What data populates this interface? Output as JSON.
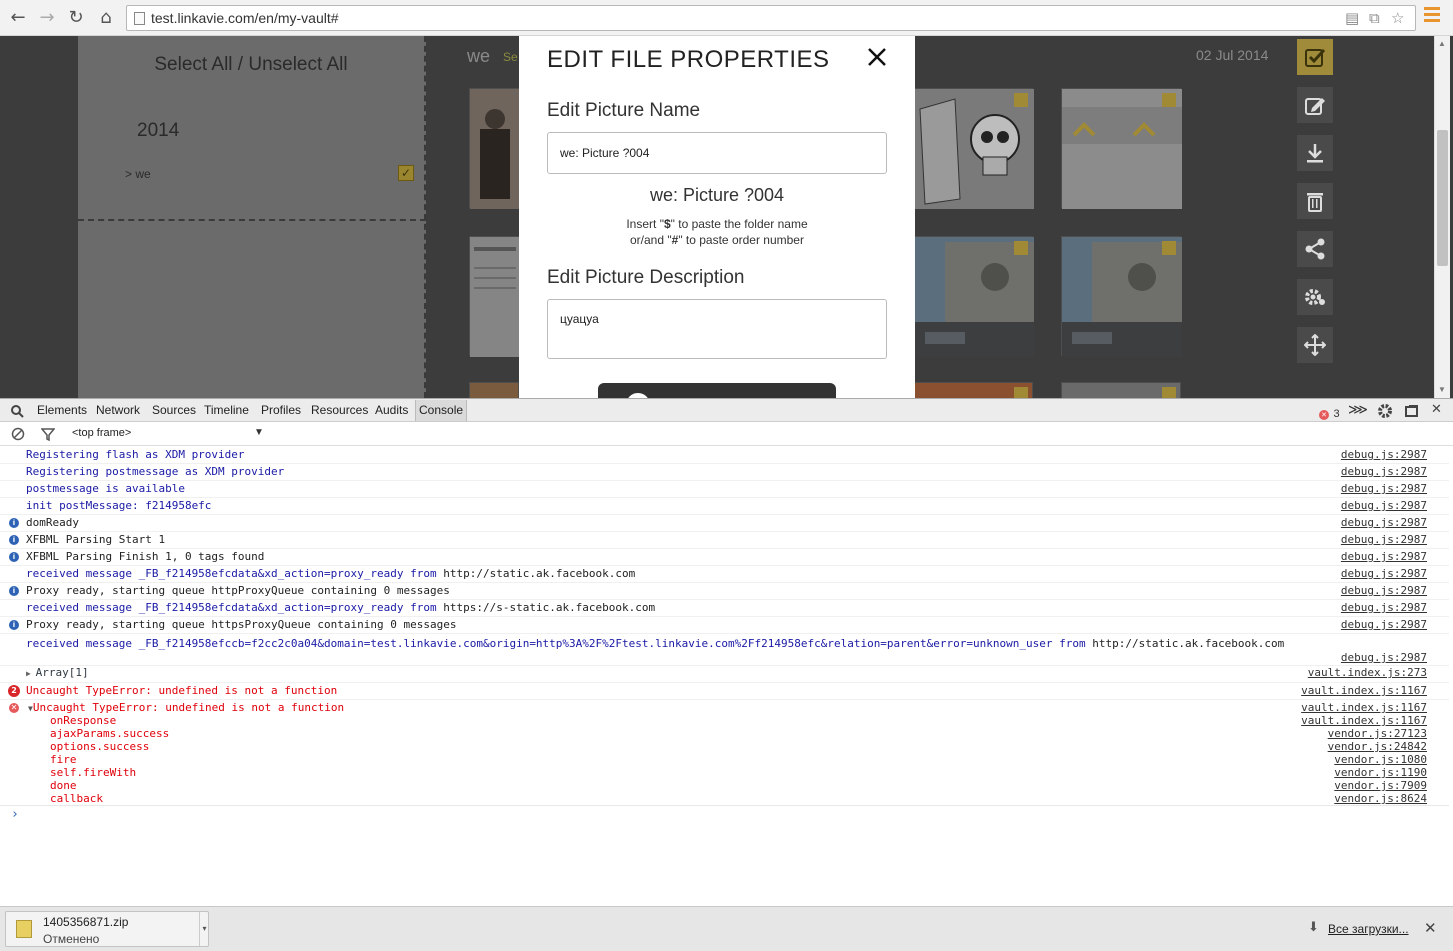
{
  "browser": {
    "url": "test.linkavie.com/en/my-vault#"
  },
  "page": {
    "select_all": "Select All / Unselect All",
    "year": "2014",
    "folder_item": "> we",
    "folder_title": "we",
    "folder_select": "Se",
    "date": "02 Jul 2014",
    "tools": [
      "select-icon",
      "edit-icon",
      "download-icon",
      "trash-icon",
      "share-icon",
      "settings-icon",
      "move-icon"
    ],
    "accent": "#a08a35"
  },
  "modal": {
    "title": "EDIT FILE PROPERTIES",
    "name_label": "Edit Picture Name",
    "name_value": "we: Picture ?004",
    "name_preview": "we: Picture ?004",
    "hint_insert": "Insert \"",
    "hint_dollar": "$",
    "hint_folder": "\" to paste the folder name",
    "hint_or": "or/and \"",
    "hint_hash": "#",
    "hint_order": "\" to paste order number",
    "desc_label": "Edit Picture Description",
    "desc_value": "цуацуа"
  },
  "devtools": {
    "tabs": [
      "Elements",
      "Network",
      "Sources",
      "Timeline",
      "Profiles",
      "Resources",
      "Audits",
      "Console"
    ],
    "active_tab": "Console",
    "error_count": "3",
    "frame": "<top frame>",
    "prompt": "›",
    "logs": [
      {
        "type": "log",
        "color": "blue",
        "text": "Registering flash as XDM provider",
        "src": "debug.js:2987"
      },
      {
        "type": "log",
        "color": "blue",
        "text": "Registering postmessage as XDM provider",
        "src": "debug.js:2987"
      },
      {
        "type": "log",
        "color": "blue",
        "text": "postmessage is available",
        "src": "debug.js:2987"
      },
      {
        "type": "log",
        "color": "blue",
        "text": "init postMessage: f214958efc",
        "src": "debug.js:2987"
      },
      {
        "type": "info",
        "color": "gray",
        "text": "domReady",
        "src": "debug.js:2987"
      },
      {
        "type": "info",
        "color": "gray",
        "text": "XFBML Parsing Start 1",
        "src": "debug.js:2987"
      },
      {
        "type": "info",
        "color": "gray",
        "text": "XFBML Parsing Finish 1, 0 tags found",
        "src": "debug.js:2987"
      },
      {
        "type": "log",
        "color": "blue",
        "text": "received message _FB_f214958efcdata&xd_action=proxy_ready from ",
        "extra": "http://static.ak.facebook.com",
        "src": "debug.js:2987"
      },
      {
        "type": "info",
        "color": "gray",
        "text": "Proxy ready, starting queue httpProxyQueue containing 0 messages",
        "src": "debug.js:2987"
      },
      {
        "type": "log",
        "color": "blue",
        "text": "received message _FB_f214958efcdata&xd_action=proxy_ready from ",
        "extra": "https://s-static.ak.facebook.com",
        "src": "debug.js:2987"
      },
      {
        "type": "info",
        "color": "gray",
        "text": "Proxy ready, starting queue httpsProxyQueue containing 0 messages",
        "src": "debug.js:2987"
      }
    ],
    "long_log": {
      "text": "received message _FB_f214958efccb=f2cc2c0a04&domain=test.linkavie.com&origin=http%3A%2F%2Ftest.linkavie.com%2Ff214958efc&relation=parent&error=unknown_user from ",
      "extra": "http://static.ak.facebook.com",
      "src": "debug.js:2987"
    },
    "array_log": {
      "text": "Array[1]",
      "src": "vault.index.js:273"
    },
    "error1": {
      "badge": "2",
      "text": "Uncaught TypeError: undefined is not a function",
      "src": "vault.index.js:1167"
    },
    "error2": {
      "text": "Uncaught TypeError: undefined is not a function",
      "src": "vault.index.js:1167"
    },
    "stack": [
      {
        "fn": "onResponse",
        "src": "vault.index.js:1167"
      },
      {
        "fn": "ajaxParams.success",
        "src": "vendor.js:27123"
      },
      {
        "fn": "options.success",
        "src": "vendor.js:24842"
      },
      {
        "fn": "fire",
        "src": "vendor.js:1080"
      },
      {
        "fn": "self.fireWith",
        "src": "vendor.js:1190"
      },
      {
        "fn": "done",
        "src": "vendor.js:7909"
      },
      {
        "fn": "callback",
        "src": "vendor.js:8624"
      }
    ]
  },
  "downloads": {
    "file_name": "1405356871.zip",
    "status": "Отменено",
    "show_all": "Все загрузки..."
  }
}
